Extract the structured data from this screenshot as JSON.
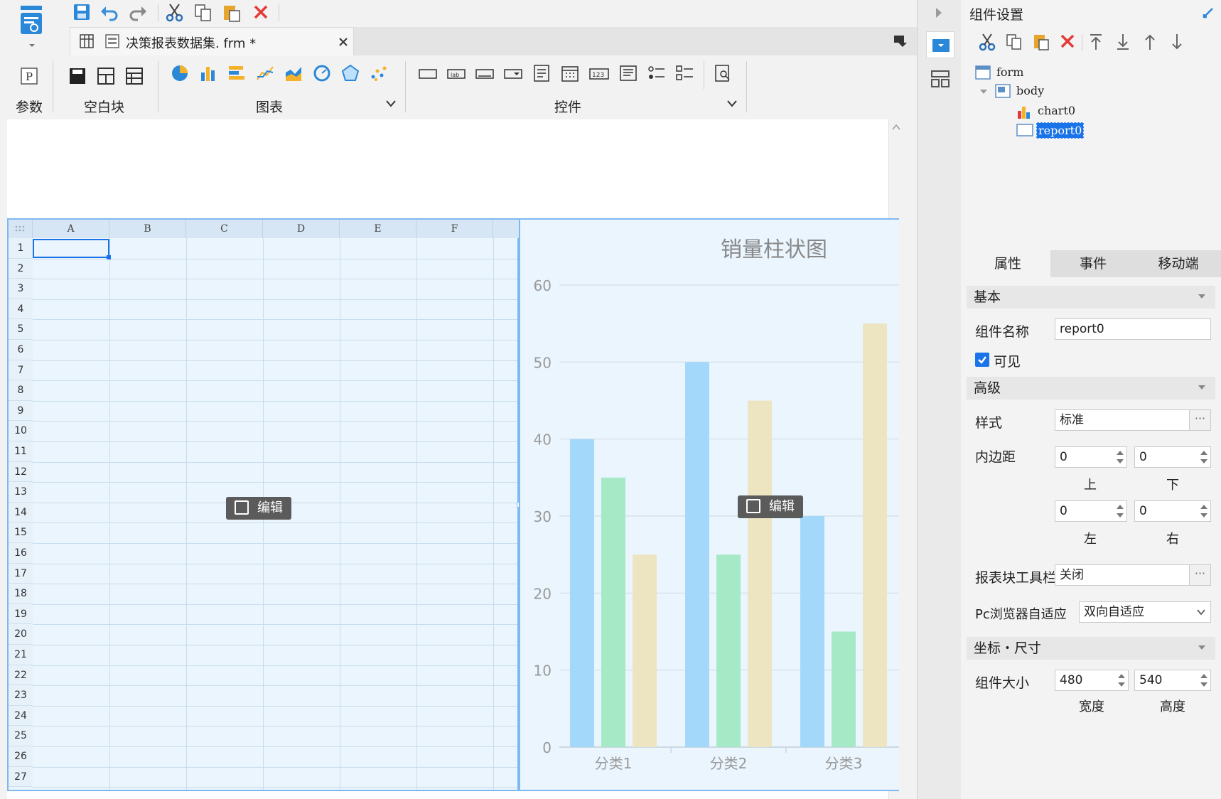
{
  "toolbar": {
    "doc_tab_title": "决策报表数据集. frm *",
    "groups": {
      "param_label": "参数",
      "blank_label": "空白块",
      "chart_label": "图表",
      "widget_label": "控件"
    }
  },
  "sheet": {
    "columns": [
      "A",
      "B",
      "C",
      "D",
      "E",
      "F"
    ],
    "rows": [
      "1",
      "2",
      "3",
      "4",
      "5",
      "6",
      "7",
      "8",
      "9",
      "10",
      "11",
      "12",
      "13",
      "14",
      "15",
      "16",
      "17",
      "18",
      "19",
      "20",
      "21",
      "22",
      "23",
      "24",
      "25",
      "26",
      "27"
    ],
    "edit_label": "编辑"
  },
  "chart_data": {
    "type": "bar",
    "title": "销量柱状图",
    "categories": [
      "分类1",
      "分类2",
      "分类3"
    ],
    "series": [
      {
        "values": [
          40,
          50,
          30
        ],
        "color": "#a3d8fb"
      },
      {
        "values": [
          35,
          25,
          15
        ],
        "color": "#a6e9c6"
      },
      {
        "values": [
          25,
          45,
          55
        ],
        "color": "#ede5c2"
      }
    ],
    "yticks": [
      "0",
      "10",
      "20",
      "30",
      "40",
      "50",
      "60"
    ],
    "ylim": [
      0,
      60
    ],
    "grid": true,
    "edit_label": "编辑"
  },
  "panel": {
    "title": "组件设置",
    "tree": {
      "form": "form",
      "body": "body",
      "chart": "chart0",
      "report": "report0"
    },
    "tabs": [
      "属性",
      "事件",
      "移动端"
    ],
    "sections": {
      "basic": "基本",
      "advanced": "高级",
      "coords": "坐标・尺寸"
    },
    "name_label": "组件名称",
    "name_value": "report0",
    "visible_label": "可见",
    "style_label": "样式",
    "style_value": "标准",
    "padding_label": "内边距",
    "padding": {
      "top": "0",
      "bottom": "0",
      "left": "0",
      "right": "0"
    },
    "padding_sub": {
      "top": "上",
      "bottom": "下",
      "left": "左",
      "right": "右"
    },
    "toolbar_label": "报表块工具栏",
    "toolbar_value": "关闭",
    "adapt_label": "Pc浏览器自适应",
    "adapt_value": "双向自适应",
    "size_label": "组件大小",
    "width_value": "480",
    "height_value": "540",
    "width_label": "宽度",
    "height_label": "高度",
    "ellipsis": "···"
  },
  "colors": {
    "accent": "#1e88e5",
    "selection": "#1a73e8"
  }
}
